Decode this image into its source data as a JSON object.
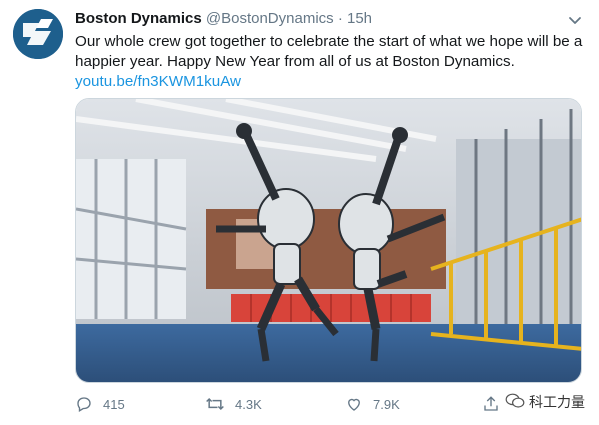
{
  "tweet": {
    "author_name": "Boston Dynamics",
    "handle": "@BostonDynamics",
    "separator": "·",
    "time": "15h",
    "text": "Our whole crew got together to celebrate the start of what we hope will be a happier year. Happy New Year from all of us at Boston Dynamics.",
    "link": "youtu.be/fn3KWM1kuAw"
  },
  "actions": {
    "replies": "415",
    "retweets": "4.3K",
    "likes": "7.9K"
  },
  "watermark": {
    "text": "科工力量"
  },
  "icons": {
    "avatar": "boston-dynamics-logo",
    "menu": "chevron-down-icon",
    "reply": "reply-icon",
    "retweet": "retweet-icon",
    "like": "heart-icon",
    "share": "share-icon",
    "watermark": "wechat-icon"
  },
  "colors": {
    "link": "#1b95e0",
    "secondary_text": "#657786",
    "avatar_bg": "#1e5f8d"
  }
}
